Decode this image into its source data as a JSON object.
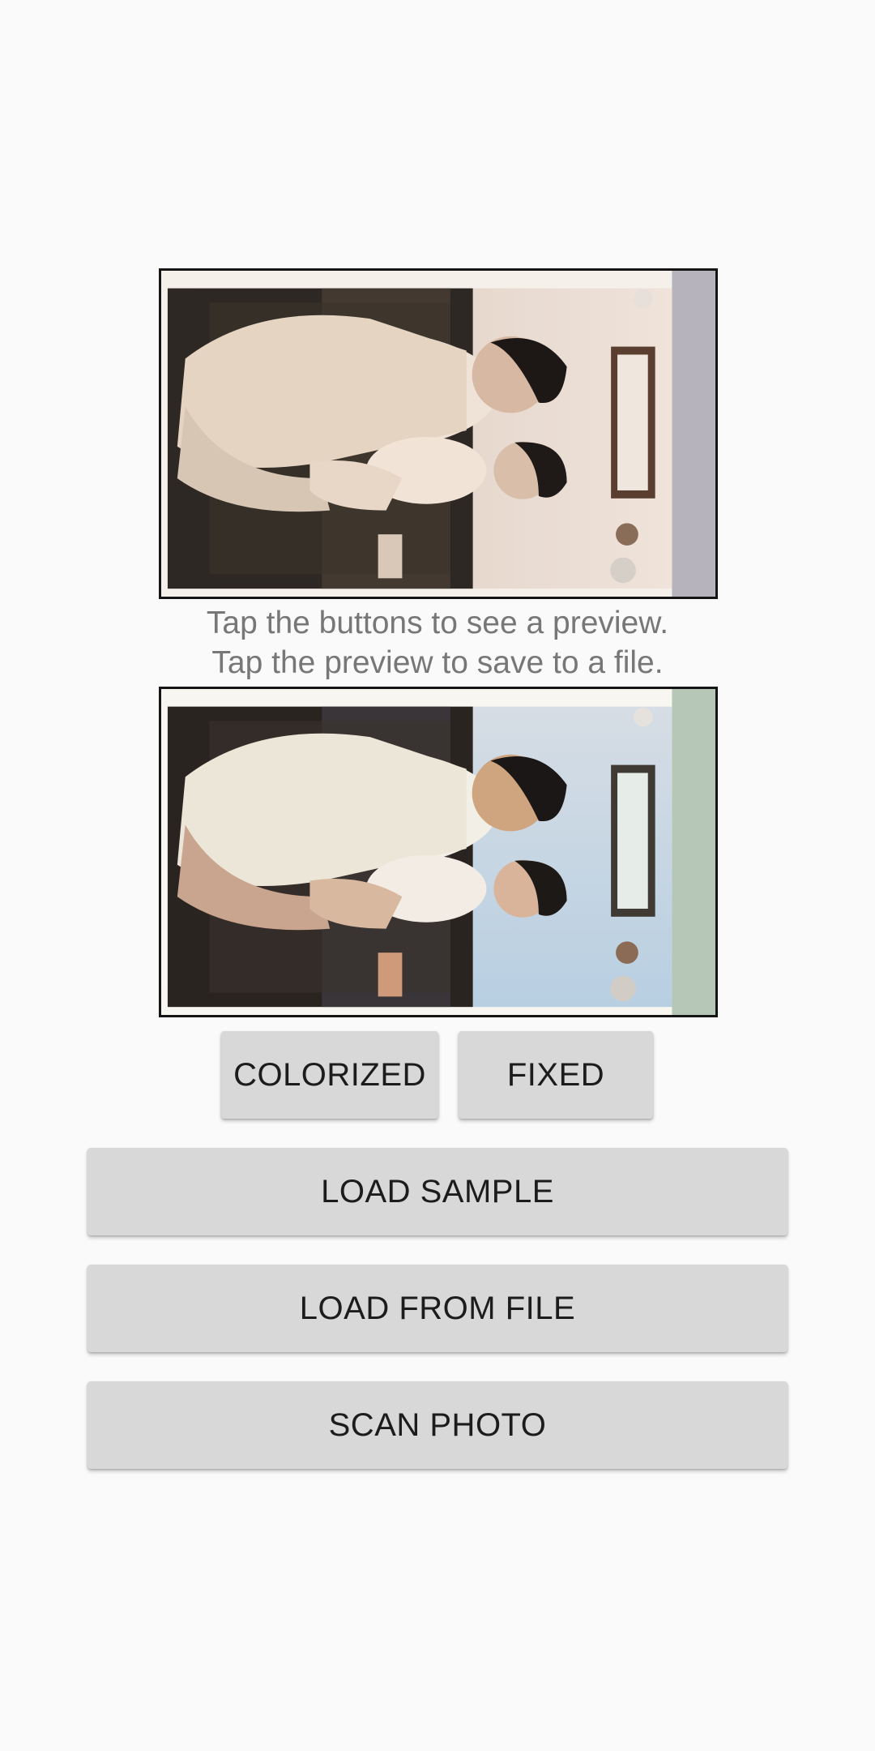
{
  "hint": {
    "line1": "Tap the buttons to see a preview.",
    "line2": "Tap the preview to save to a file."
  },
  "preview_buttons": {
    "colorized_label": "COLORIZED",
    "fixed_label": "FIXED"
  },
  "actions": {
    "load_sample_label": "LOAD SAMPLE",
    "load_from_file_label": "LOAD FROM FILE",
    "scan_photo_label": "SCAN PHOTO"
  },
  "colors": {
    "background": "#fafafa",
    "button_bg": "#d7d8d7",
    "button_text": "#1c1c1c",
    "hint_text": "#777777",
    "frame_border": "#151515"
  }
}
